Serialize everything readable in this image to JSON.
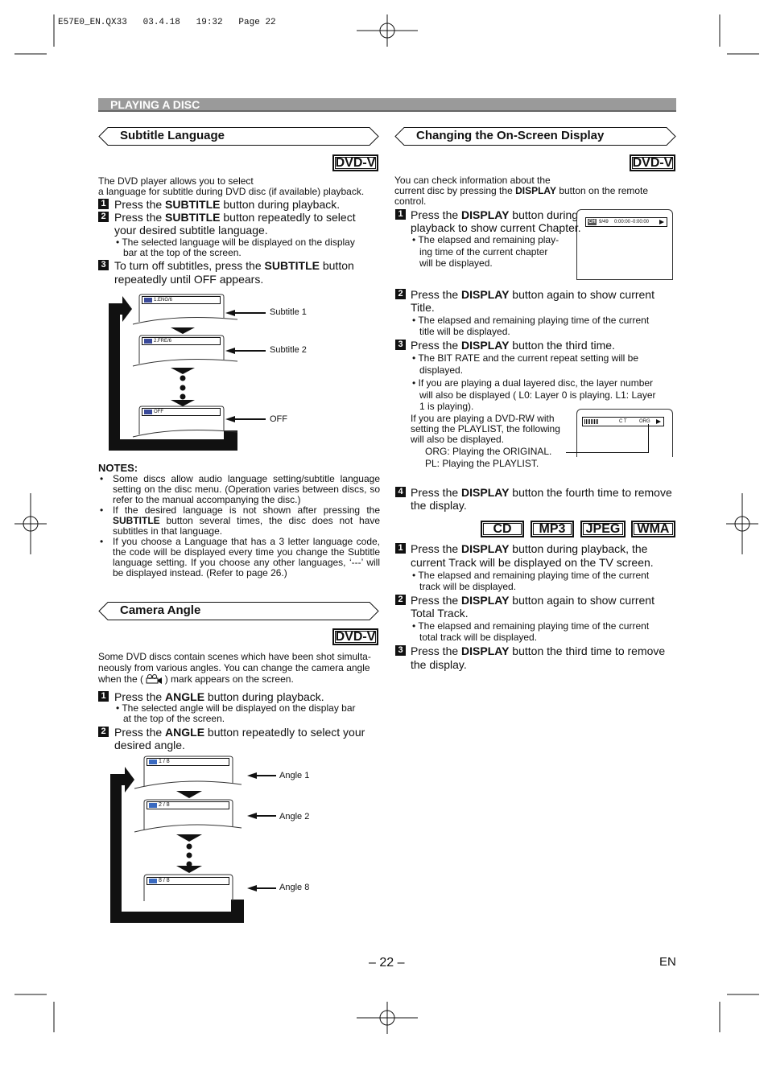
{
  "slug": "E57E0_EN.QX33   03.4.18   19:32   Page 22",
  "section": "PLAYING A DISC",
  "dvdv": "DVD-V",
  "subtitle": {
    "title": "Subtitle Language",
    "intro": [
      "The DVD player allows you to select",
      "a language for subtitle during DVD disc (if available) playback."
    ],
    "s1": {
      "n": "1",
      "pre": "Press the ",
      "key": "SUBTITLE",
      "post": " button during playback."
    },
    "s2": {
      "n": "2",
      "pre": "Press the ",
      "key": "SUBTITLE",
      "post": " button repeatedly to select",
      "l2": "your desired subtitle language."
    },
    "b2": [
      "• The selected language will be displayed on the display",
      "bar at the top of the screen."
    ],
    "s3": {
      "n": "3",
      "pre": "To turn off subtitles, press the ",
      "key": "SUBTITLE",
      "post": " button",
      "l2": "repeatedly until OFF appears."
    },
    "screens": [
      "1.ENG/6",
      "2.FRE/6",
      "OFF"
    ],
    "labels": [
      "Subtitle 1",
      "Subtitle 2",
      "OFF"
    ]
  },
  "notes": {
    "title": "NOTES:",
    "items": [
      "Some discs allow audio language setting/subtitle language setting on the disc menu. (Operation varies between discs, so refer to the manual accompanying the disc.)",
      {
        "pre": "If the desired language is not shown after pressing the ",
        "key": "SUBTITLE",
        "post": " button several times, the disc does not have subtitles in that language."
      },
      "If you choose a Language that has a 3 letter language code, the code will be displayed every time you change the Subtitle language setting. If you choose any other languages, ‘---’ will be displayed instead. (Refer to page 26.)"
    ]
  },
  "angle": {
    "title": "Camera Angle",
    "intro": [
      "Some DVD discs contain scenes which have been shot simulta-",
      "neously from various angles. You can change the camera angle",
      "when the (        ) mark appears on the screen."
    ],
    "s1": {
      "n": "1",
      "pre": "Press the ",
      "key": "ANGLE",
      "post": " button during playback."
    },
    "b1": [
      "• The selected angle will be displayed on the display bar",
      "at the top of the screen."
    ],
    "s2": {
      "n": "2",
      "pre": "Press the ",
      "key": "ANGLE",
      "post": " button repeatedly to select your",
      "l2": "desired angle."
    },
    "screens": [
      "1 / 8",
      "2 / 8",
      "8 / 8"
    ],
    "labels": [
      "Angle 1",
      "Angle 2",
      "Angle 8"
    ]
  },
  "display": {
    "title": "Changing the On-Screen Display",
    "intro": [
      "You can check information about the",
      "current disc by pressing the ",
      "DISPLAY",
      " button on the remote",
      "control."
    ],
    "s1": {
      "n": "1",
      "pre": "Press the ",
      "key": "DISPLAY",
      "post": " button during",
      "l2": "playback to show current Chapter."
    },
    "b1": [
      "• The elapsed and remaining play-",
      "ing time of the current chapter",
      "will be displayed."
    ],
    "screen1": {
      "ch": "CH",
      "num": "9/49",
      "t1": "0:00:00",
      "t2": "-0:00:00"
    },
    "s2": {
      "n": "2",
      "pre": "Press the ",
      "key": "DISPLAY",
      "post": " button again to show current",
      "l2": "Title."
    },
    "b2": [
      "• The elapsed and remaining playing time of the current",
      "title will be displayed."
    ],
    "s3": {
      "n": "3",
      "pre": "Press the ",
      "key": "DISPLAY",
      "post": " button the third time."
    },
    "b3": [
      "• The BIT RATE and the current repeat setting will be",
      "displayed.",
      "• If you are playing a dual layered disc, the layer number",
      "will also be displayed ( L0: Layer 0 is playing.  L1: Layer",
      "1 is playing)."
    ],
    "rw": [
      "If you are playing a DVD-RW with",
      "setting the PLAYLIST, the following",
      "will also be displayed.",
      "ORG: Playing the ORIGINAL.",
      "PL: Playing the PLAYLIST."
    ],
    "screen2": {
      "rep": "C T",
      "org": "ORG"
    },
    "s4": {
      "n": "4",
      "pre": "Press the ",
      "key": "DISPLAY",
      "post": " button the fourth time to remove",
      "l2": "the display."
    }
  },
  "formats": [
    "CD",
    "MP3",
    "JPEG",
    "WMA"
  ],
  "cd": {
    "s1": {
      "n": "1",
      "pre": "Press the ",
      "key": "DISPLAY",
      "post": " button during playback, the",
      "l2": "current Track will be displayed on the TV screen."
    },
    "b1": [
      "• The elapsed and remaining playing time of the current",
      "track will be displayed."
    ],
    "s2": {
      "n": "2",
      "pre": "Press the ",
      "key": "DISPLAY",
      "post": " button again to show current",
      "l2": "Total Track."
    },
    "b2": [
      "• The elapsed and remaining playing time of the current",
      "total track will be displayed."
    ],
    "s3": {
      "n": "3",
      "pre": "Press the ",
      "key": "DISPLAY",
      "post": " button the third time to remove",
      "l2": "the display."
    }
  },
  "page": "– 22 –",
  "lang": "EN"
}
